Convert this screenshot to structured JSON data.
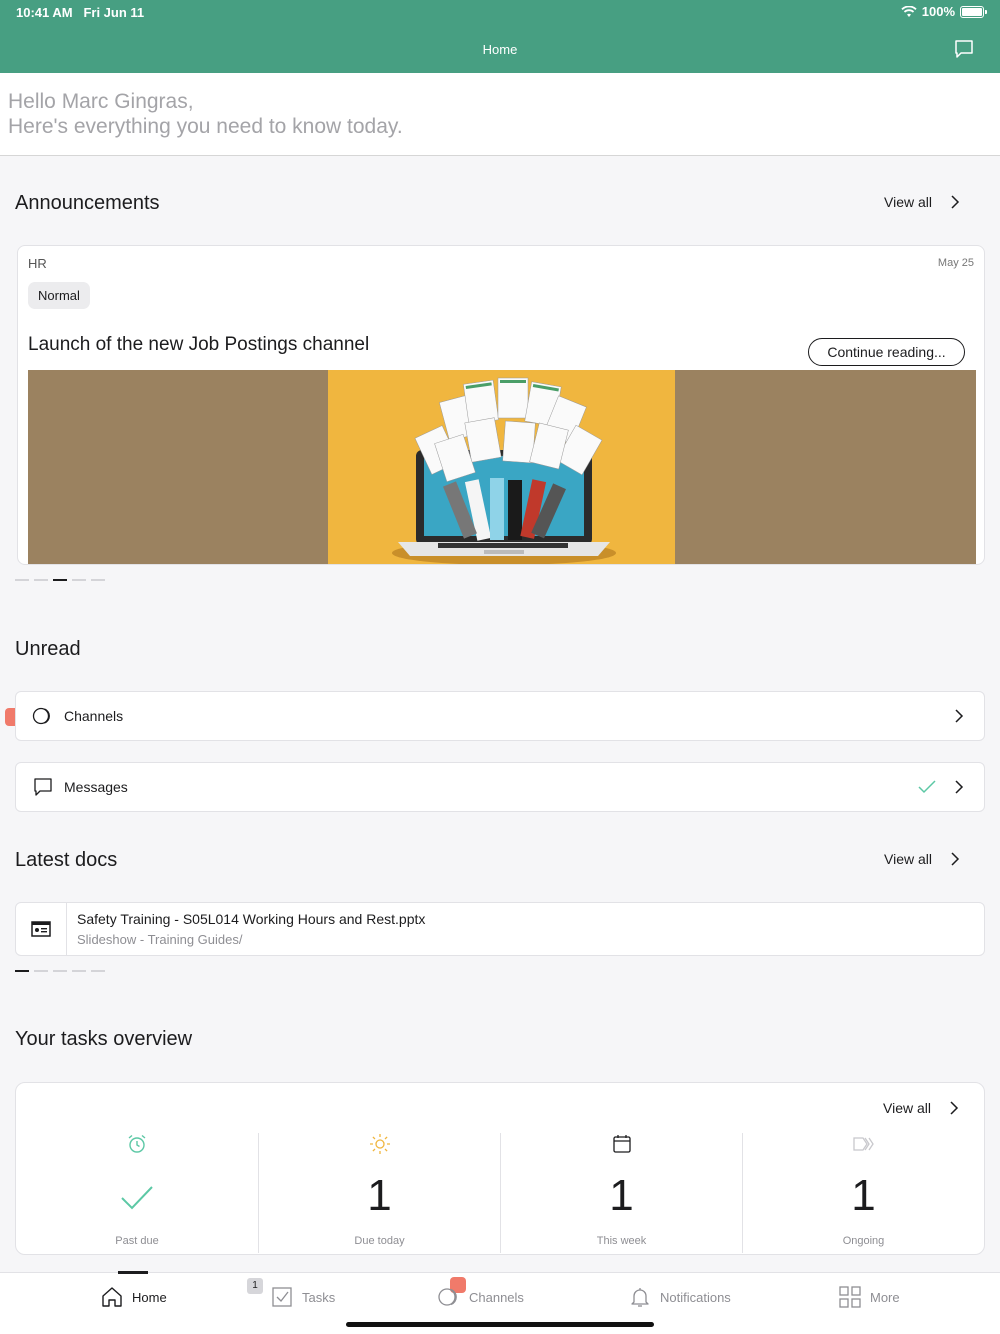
{
  "status_bar": {
    "time": "10:41 AM",
    "date": "Fri Jun 11",
    "battery": "100%"
  },
  "nav": {
    "title": "Home"
  },
  "greeting": {
    "line1": "Hello Marc Gingras,",
    "line2": "Here's everything you need to know today."
  },
  "announcements": {
    "title": "Announcements",
    "view_all": "View all",
    "card": {
      "department": "HR",
      "date": "May 25",
      "priority": "Normal",
      "headline": "Launch of the new Job Postings channel",
      "continue_label": "Continue reading..."
    },
    "pager_count": 5,
    "pager_active": 3
  },
  "unread": {
    "title": "Unread",
    "items": [
      {
        "label": "Channels",
        "icon": "channels-icon"
      },
      {
        "label": "Messages",
        "icon": "message-icon",
        "status": "read-check"
      }
    ]
  },
  "latest_docs": {
    "title": "Latest docs",
    "view_all": "View all",
    "items": [
      {
        "name": "Safety Training - S05L014 Working Hours and Rest.pptx",
        "subtitle": "Slideshow - Training Guides/"
      }
    ],
    "pager_count": 5,
    "pager_active": 1
  },
  "tasks": {
    "title": "Your tasks overview",
    "view_all": "View all",
    "columns": [
      {
        "label": "Past due",
        "value": "",
        "icon": "alarm-icon"
      },
      {
        "label": "Due today",
        "value": "1",
        "icon": "sun-icon"
      },
      {
        "label": "This week",
        "value": "1",
        "icon": "calendar-icon"
      },
      {
        "label": "Ongoing",
        "value": "1",
        "icon": "progress-icon"
      }
    ]
  },
  "tabbar": {
    "tabs": [
      {
        "label": "Home",
        "active": true
      },
      {
        "label": "Tasks",
        "badge": "1"
      },
      {
        "label": "Channels"
      },
      {
        "label": "Notifications"
      },
      {
        "label": "More"
      }
    ]
  },
  "colors": {
    "header": "#479f82",
    "accent_green": "#5cc8a5",
    "alert_red": "#f07a6a"
  }
}
